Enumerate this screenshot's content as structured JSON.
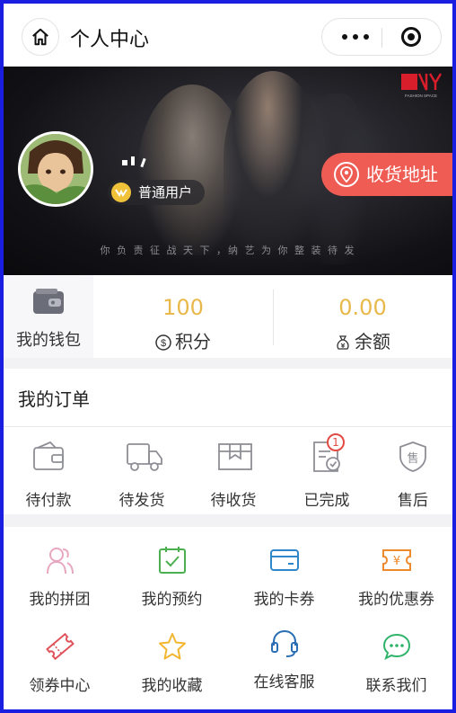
{
  "header": {
    "title": "个人中心"
  },
  "banner": {
    "slogan": "你 负 责 征 战 天 下 ，纳 艺 为 你 整 装 待 发",
    "brand_text": "FASHION SPACE",
    "user_level": "普通用户",
    "address_button": "收货地址"
  },
  "assets": {
    "wallet_label": "我的钱包",
    "points_value": "100",
    "points_label": "积分",
    "balance_value": "0.00",
    "balance_label": "余额"
  },
  "orders": {
    "title": "我的订单",
    "items": [
      {
        "label": "待付款",
        "icon": "wallet-icon"
      },
      {
        "label": "待发货",
        "icon": "truck-icon"
      },
      {
        "label": "待收货",
        "icon": "package-icon"
      },
      {
        "label": "已完成",
        "icon": "completed-doc-icon",
        "badge": "1"
      },
      {
        "label": "售后",
        "icon": "after-sale-shield-icon"
      }
    ]
  },
  "services": {
    "items": [
      {
        "label": "我的拼团",
        "icon": "group-buy-icon"
      },
      {
        "label": "我的预约",
        "icon": "calendar-check-icon"
      },
      {
        "label": "我的卡券",
        "icon": "card-icon"
      },
      {
        "label": "我的优惠券",
        "icon": "coupon-yen-icon"
      },
      {
        "label": "领券中心",
        "icon": "ticket-icon"
      },
      {
        "label": "我的收藏",
        "icon": "star-icon"
      },
      {
        "label": "在线客服",
        "icon": "headset-icon"
      },
      {
        "label": "联系我们",
        "icon": "chat-bubble-icon"
      }
    ]
  },
  "colors": {
    "accent_gold": "#e8b94a",
    "address_red": "#ee5c54",
    "badge_red": "#e24b44",
    "frame_blue": "#1a1ee0"
  }
}
